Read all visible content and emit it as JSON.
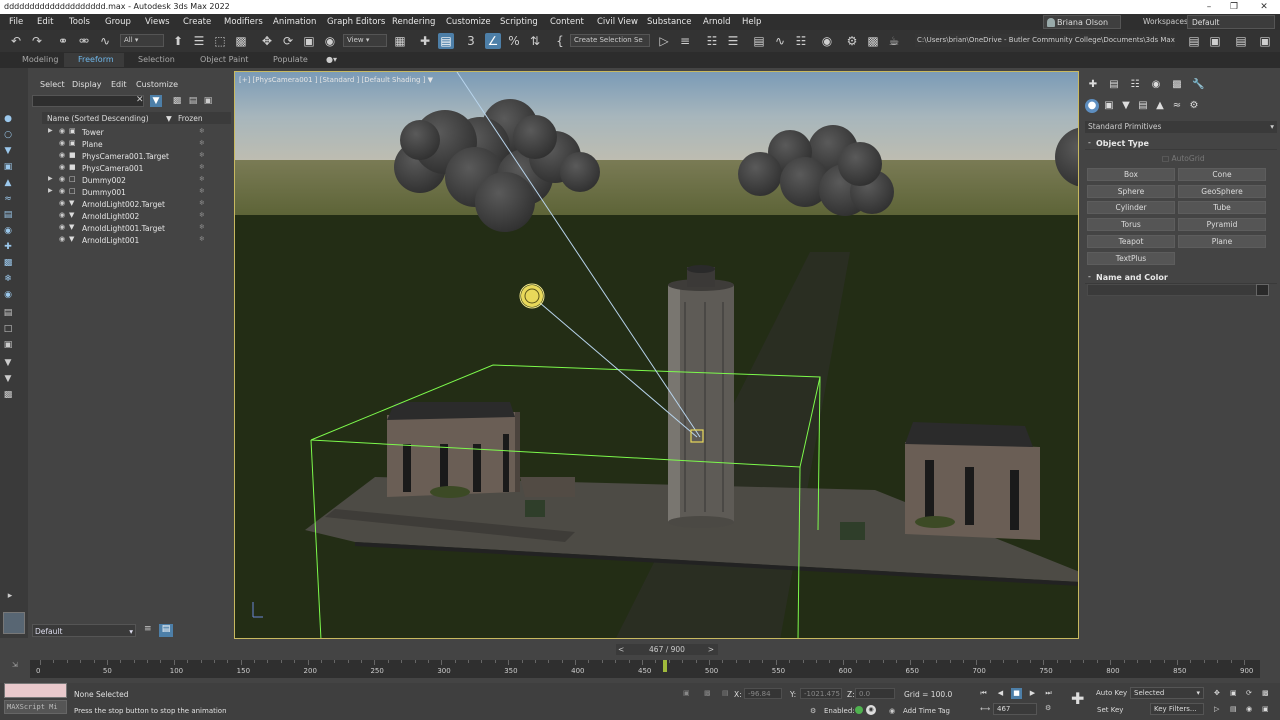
{
  "window": {
    "title": "dddddddddddddddddddd.max - Autodesk 3ds Max 2022",
    "min_icon": "minimize-icon",
    "restore_icon": "restore-icon",
    "close_icon": "close-icon"
  },
  "menu": {
    "items": [
      "File",
      "Edit",
      "Tools",
      "Group",
      "Views",
      "Create",
      "Modifiers",
      "Animation",
      "Graph Editors",
      "Rendering",
      "Customize",
      "Scripting",
      "Content",
      "Civil View",
      "Substance",
      "Arnold",
      "Help"
    ],
    "user": "Briana Olson",
    "workspaces_label": "Workspaces:",
    "workspace_value": "Default"
  },
  "toolbar": {
    "filter_value": "All",
    "ref_coord_value": "View",
    "selection_set_value": "Create Selection Se",
    "project_path": "C:\\Users\\brian\\OneDrive - Butler Community College\\Documents\\3ds Max 2022",
    "accent": "#4d7fa8"
  },
  "ribbon": {
    "tabs": [
      "Modeling",
      "Freeform",
      "Selection",
      "Object Paint",
      "Populate"
    ],
    "active": "Freeform"
  },
  "scene_explorer": {
    "tabs": [
      "Select",
      "Display",
      "Edit",
      "Customize"
    ],
    "columns": {
      "name": "Name (Sorted Descending)",
      "frozen": "Frozen"
    },
    "rows": [
      {
        "name": "Tower",
        "expandable": true,
        "icon": "geometry-icon"
      },
      {
        "name": "Plane",
        "expandable": false,
        "icon": "geometry-icon"
      },
      {
        "name": "PhysCamera001.Target",
        "expandable": false,
        "icon": "camera-target-icon"
      },
      {
        "name": "PhysCamera001",
        "expandable": false,
        "icon": "camera-icon"
      },
      {
        "name": "Dummy002",
        "expandable": true,
        "icon": "dummy-icon"
      },
      {
        "name": "Dummy001",
        "expandable": true,
        "icon": "dummy-icon"
      },
      {
        "name": "ArnoldLight002.Target",
        "expandable": false,
        "icon": "light-target-icon"
      },
      {
        "name": "ArnoldLight002",
        "expandable": false,
        "icon": "light-icon"
      },
      {
        "name": "ArnoldLight001.Target",
        "expandable": false,
        "icon": "light-target-icon"
      },
      {
        "name": "ArnoldLight001",
        "expandable": false,
        "icon": "light-icon"
      }
    ],
    "layer": "Default"
  },
  "viewport": {
    "label": "[+] [PhysCamera001 ] [Standard ] [Default Shading ]",
    "border_color": "#c8b960",
    "selection_color": "#7dfa4c"
  },
  "command_panel": {
    "category": "Standard Primitives",
    "object_type_title": "Object Type",
    "autogrid": "AutoGrid",
    "buttons": [
      "Box",
      "Cone",
      "Sphere",
      "GeoSphere",
      "Cylinder",
      "Tube",
      "Torus",
      "Pyramid",
      "Teapot",
      "Plane",
      "TextPlus"
    ],
    "name_color_title": "Name and Color"
  },
  "timeline": {
    "frame_display": "467 / 900",
    "current_frame": 467,
    "total_frames": 900,
    "ticks": [
      "0",
      "50",
      "100",
      "150",
      "200",
      "250",
      "300",
      "350",
      "400",
      "450",
      "500",
      "550",
      "600",
      "650",
      "700",
      "750",
      "800",
      "850",
      "900"
    ]
  },
  "status": {
    "maxscript_placeholder": "MAXScript Mi",
    "selection": "None Selected",
    "prompt": "Press the stop button to stop the animation",
    "x_label": "X:",
    "x_value": "-96.84",
    "y_label": "Y:",
    "y_value": "-1021.475",
    "z_label": "Z:",
    "z_value": "0.0",
    "grid": "Grid = 100.0",
    "enabled_label": "Enabled:",
    "add_time_tag": "Add Time Tag",
    "frame_field": "467",
    "auto_key": "Auto Key",
    "set_key": "Set Key",
    "key_mode_value": "Selected",
    "key_filters": "Key Filters..."
  }
}
